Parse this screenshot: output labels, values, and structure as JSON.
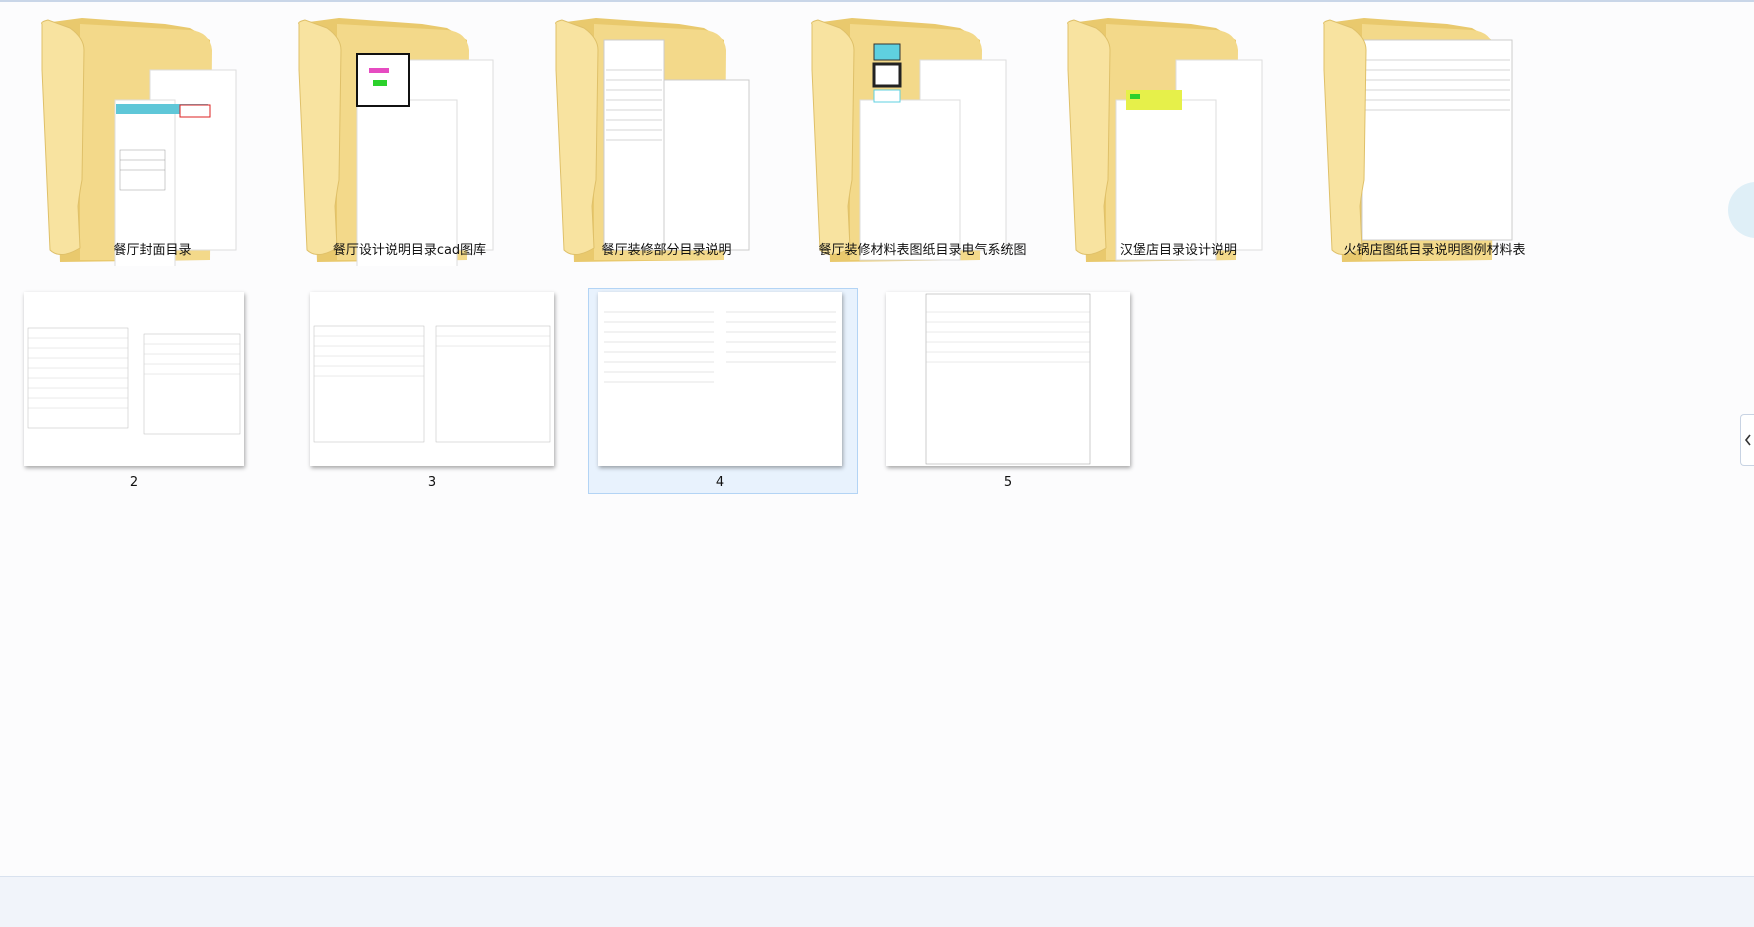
{
  "folders": [
    {
      "name": "餐厅封面目录"
    },
    {
      "name": "餐厅设计说明目录cad图库"
    },
    {
      "name": "餐厅装修部分目录说明"
    },
    {
      "name": "餐厅装修材料表图纸目录电气系统图"
    },
    {
      "name": "汉堡店目录设计说明"
    },
    {
      "name": "火锅店图纸目录说明图例材料表"
    }
  ],
  "files": [
    {
      "name": "2"
    },
    {
      "name": "3"
    },
    {
      "name": "4",
      "selected": true
    },
    {
      "name": "5"
    }
  ],
  "side_tab": {
    "icon": "chevron-left-icon"
  },
  "colors": {
    "selection_bg": "#e8f2fd",
    "selection_border": "#b3d4f5",
    "folder_light": "#f8e3a0",
    "folder_dark": "#e9c96d"
  }
}
